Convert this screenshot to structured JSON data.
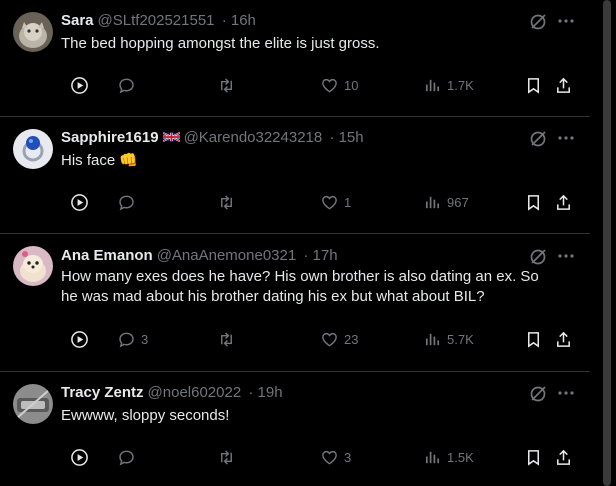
{
  "tweets": [
    {
      "name": "Sara",
      "handle": "@SLtf202521551",
      "time": "· 16h",
      "text": "The bed hopping amongst the elite is just gross.",
      "replies": "",
      "reposts": "",
      "likes": "10",
      "views": "1.7K",
      "avatar": "cat-photo",
      "flag": ""
    },
    {
      "name": "Sapphire1619",
      "handle": "@Karendo32243218",
      "time": "· 15h",
      "text": "His face 👊",
      "replies": "",
      "reposts": "",
      "likes": "1",
      "views": "967",
      "avatar": "sapphire-ring",
      "flag": "uk-flag"
    },
    {
      "name": "Ana Emanon",
      "handle": "@AnaAnemone0321",
      "time": "· 17h",
      "text": "How many exes does he have? His own brother is also dating an ex. So he was mad about his brother dating his ex but what about BIL?",
      "replies": "3",
      "reposts": "",
      "likes": "23",
      "views": "5.7K",
      "avatar": "dog-photo",
      "flag": ""
    },
    {
      "name": "Tracy Zentz",
      "handle": "@noel602022",
      "time": "· 19h",
      "text": "Ewwww, sloppy seconds!",
      "replies": "",
      "reposts": "",
      "likes": "3",
      "views": "1.5K",
      "avatar": "gray-photo",
      "flag": ""
    }
  ],
  "colors": {
    "background": "#000000",
    "text": "#e7e9ea",
    "muted": "#71767b",
    "divider": "#2f3336"
  }
}
